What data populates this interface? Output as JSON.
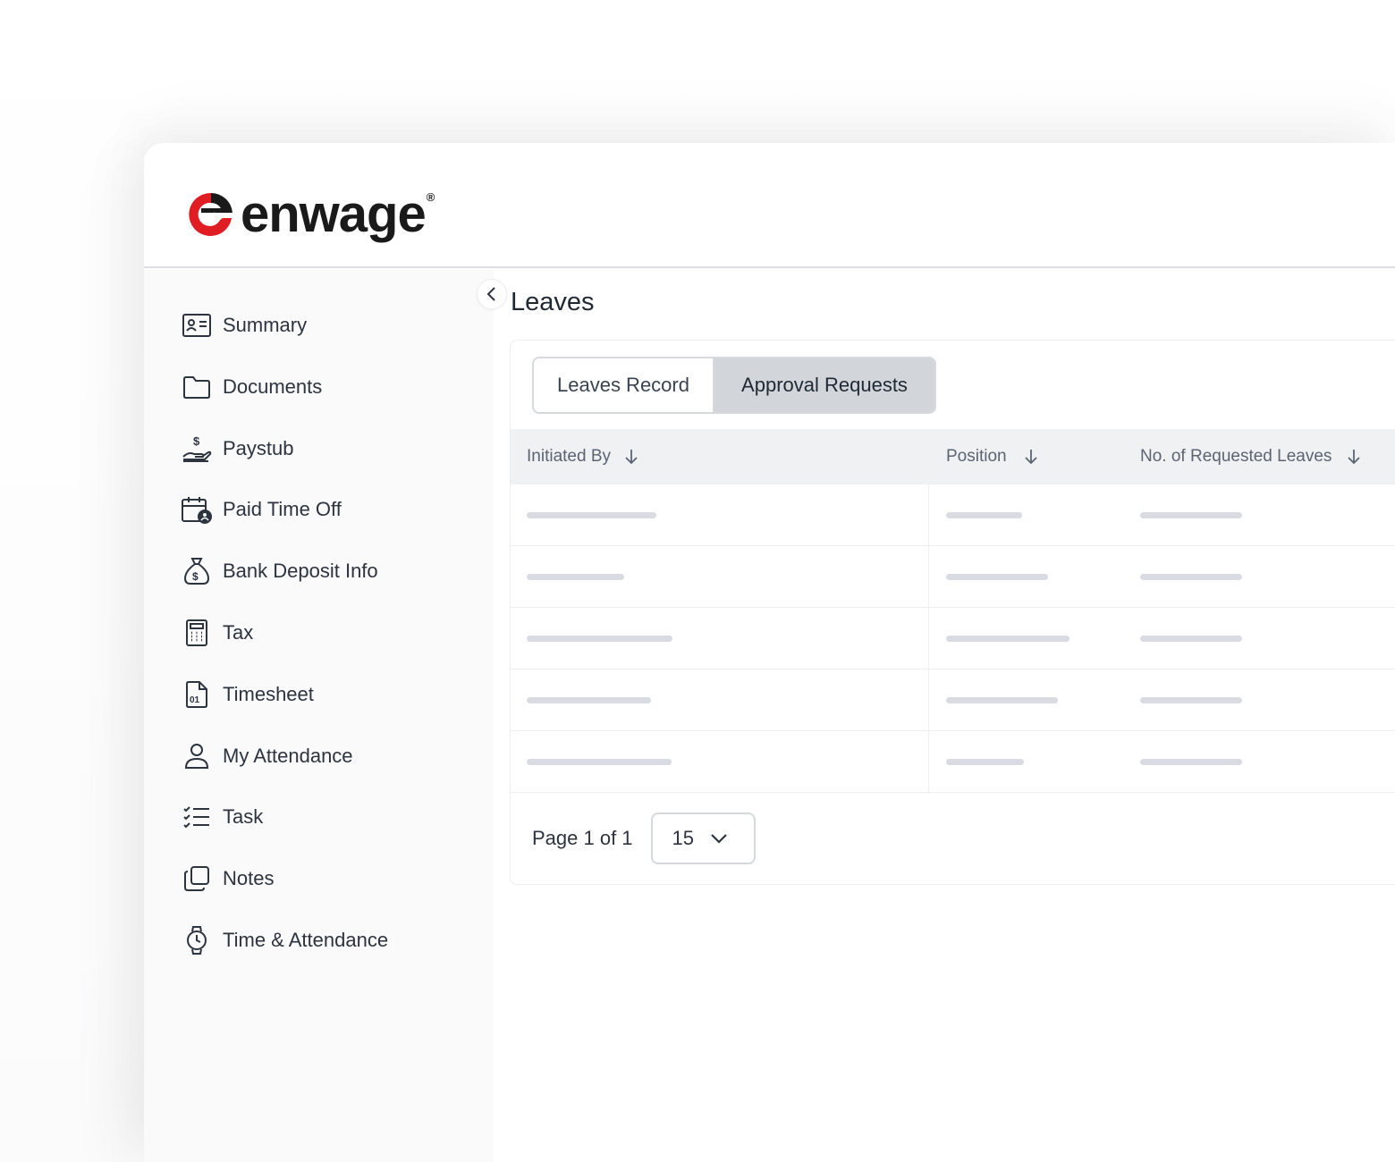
{
  "brand": {
    "name": "enwage",
    "registered": "®",
    "colors": {
      "red": "#e11d24",
      "dark": "#1a1a1a"
    }
  },
  "sidebar": {
    "items": [
      {
        "label": "Summary",
        "icon": "id-card-icon"
      },
      {
        "label": "Documents",
        "icon": "folder-icon"
      },
      {
        "label": "Paystub",
        "icon": "hand-dollar-icon"
      },
      {
        "label": "Paid Time Off",
        "icon": "calendar-user-icon"
      },
      {
        "label": "Bank Deposit Info",
        "icon": "money-bag-icon"
      },
      {
        "label": "Tax",
        "icon": "calculator-icon"
      },
      {
        "label": "Timesheet",
        "icon": "file-binary-icon"
      },
      {
        "label": "My Attendance",
        "icon": "user-icon"
      },
      {
        "label": "Task",
        "icon": "checklist-icon"
      },
      {
        "label": "Notes",
        "icon": "notes-icon"
      },
      {
        "label": "Time & Attendance",
        "icon": "watch-icon"
      }
    ]
  },
  "main": {
    "title": "Leaves",
    "tabs": [
      {
        "label": "Leaves Record",
        "active": false
      },
      {
        "label": "Approval Requests",
        "active": true
      }
    ],
    "table": {
      "columns": [
        "Initiated By",
        "Position",
        "No. of Requested Leaves"
      ],
      "row_count": 5,
      "loading": true
    },
    "pagination": {
      "text": "Page 1 of 1",
      "per_page": "15"
    }
  }
}
